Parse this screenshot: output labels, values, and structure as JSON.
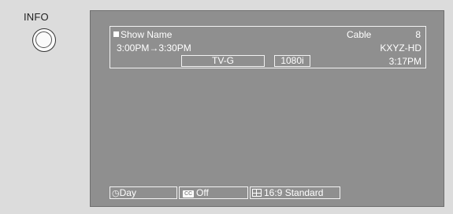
{
  "remote": {
    "label": "INFO"
  },
  "banner": {
    "show_name": "Show Name",
    "source": "Cable",
    "channel": "8",
    "time_range": "3:00PM→3:30PM",
    "station": "KXYZ-HD",
    "rating": "TV-G",
    "resolution": "1080i",
    "clock": "3:17PM"
  },
  "status": {
    "day": "Day",
    "cc_icon": "CC",
    "cc": "Off",
    "aspect": "16:9 Standard"
  },
  "colors": {
    "screen": "#8f8f8f",
    "text": "#ffffff",
    "background": "#dcdcdc"
  },
  "icons": [
    "clock-icon",
    "cc-icon",
    "aspect-ratio-icon",
    "info-button"
  ]
}
